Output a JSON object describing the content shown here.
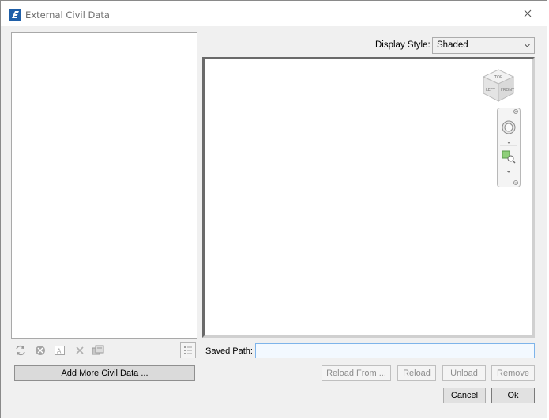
{
  "window": {
    "title": "External Civil Data",
    "close_glyph": "✕"
  },
  "left_panel": {
    "tree_items": [],
    "toolbar_icons": [
      "refresh-icon",
      "detach-icon",
      "rename-icon",
      "delete-icon",
      "properties-icon"
    ],
    "list_view_icon": "list-view-icon",
    "add_button_label": "Add More Civil Data ..."
  },
  "display_style": {
    "label": "Display Style:",
    "value": "Shaded"
  },
  "viewport": {
    "viewcube_faces": [
      "TOP",
      "LEFT",
      "FRONT"
    ],
    "nav_tools": [
      "orbit-icon",
      "zoom-window-icon"
    ]
  },
  "saved_path": {
    "label": "Saved Path:",
    "value": ""
  },
  "actions": {
    "reload_from": "Reload From ...",
    "reload": "Reload",
    "unload": "Unload",
    "remove": "Remove",
    "cancel": "Cancel",
    "ok": "Ok"
  },
  "colors": {
    "accent_input_border": "#7eb4ea",
    "window_bg": "#f0f0f0",
    "logo_blue": "#1f5fa8"
  }
}
